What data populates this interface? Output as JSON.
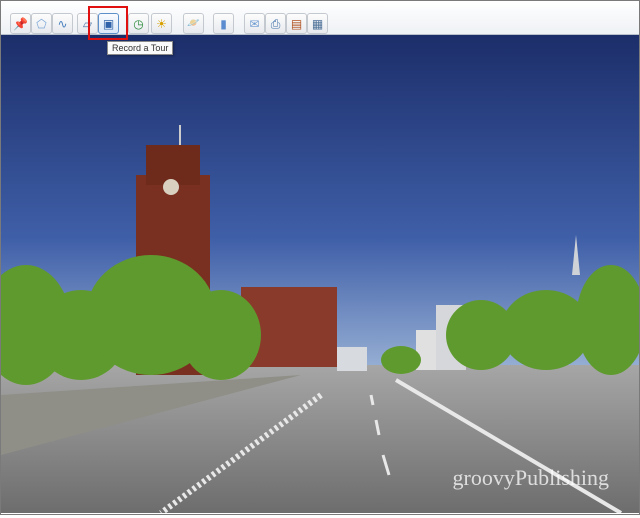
{
  "toolbar": {
    "buttons": [
      {
        "name": "add-placemark",
        "icon": "pushpin-icon",
        "glyph": "📌"
      },
      {
        "name": "add-polygon",
        "icon": "polygon-icon",
        "glyph": "⬠"
      },
      {
        "name": "add-path",
        "icon": "path-icon",
        "glyph": "∿"
      },
      {
        "name": "add-image-overlay",
        "icon": "image-overlay-icon",
        "glyph": "▱"
      },
      {
        "name": "record-tour",
        "icon": "camera-icon",
        "glyph": "▣"
      },
      {
        "name": "historical-imagery",
        "icon": "clock-icon",
        "glyph": "◷"
      },
      {
        "name": "sunlight",
        "icon": "sun-icon",
        "glyph": "☀"
      },
      {
        "name": "switch-planets",
        "icon": "planet-icon",
        "glyph": "🪐"
      },
      {
        "name": "ruler",
        "icon": "ruler-icon",
        "glyph": "▮"
      },
      {
        "name": "email",
        "icon": "envelope-icon",
        "glyph": "✉"
      },
      {
        "name": "print",
        "icon": "printer-icon",
        "glyph": "⎙"
      },
      {
        "name": "view-in-maps",
        "icon": "map-icon",
        "glyph": "▤"
      },
      {
        "name": "sidebar-toggle",
        "icon": "panel-icon",
        "glyph": "▦"
      }
    ],
    "tooltip": "Record a Tour",
    "highlight_color": "#e01010"
  },
  "watermark": "groovyPublishing"
}
